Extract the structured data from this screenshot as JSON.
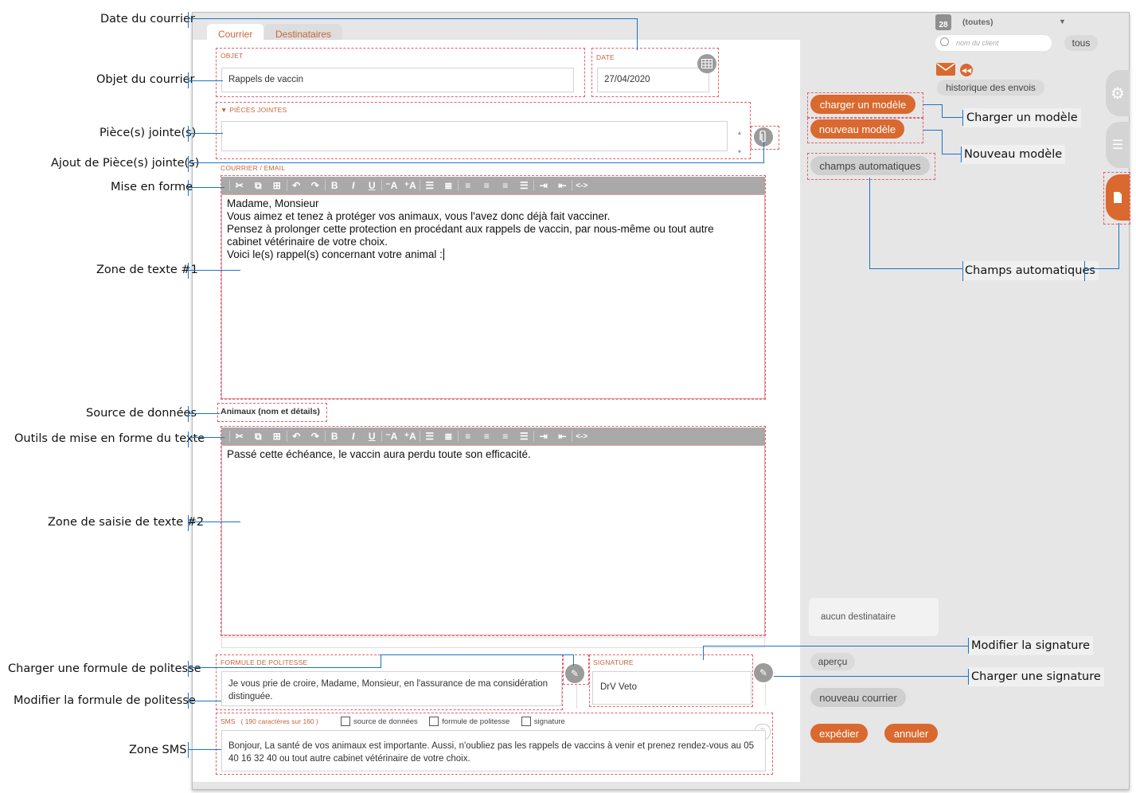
{
  "annotations": {
    "date": "Date du courrier",
    "objet": "Objet du courrier",
    "pieces": "Pièce(s) jointe(s)",
    "ajout_pieces": "Ajout de Pièce(s) jointe(s)",
    "mise_en_forme": "Mise en forme",
    "zone1": "Zone de texte #1",
    "source": "Source de données",
    "outils": "Outils de mise en forme du texte",
    "zone2": "Zone de saisie de texte #2",
    "charger_formule": "Charger une formule de politesse",
    "modifier_formule": "Modifier la formule de politesse",
    "zone_sms": "Zone SMS",
    "charger_modele": "Charger un modèle",
    "nouveau_modele": "Nouveau modèle",
    "champs_auto": "Champs automatiques",
    "modifier_signature": "Modifier la signature",
    "charger_signature": "Charger une signature"
  },
  "tabs": [
    "Courrier",
    "Destinataires"
  ],
  "objet": {
    "label": "OBJET",
    "value": "Rappels de vaccin"
  },
  "date": {
    "label": "DATE",
    "value": "27/04/2020"
  },
  "pieces": {
    "label": "PIÈCES JOINTES"
  },
  "courrier": {
    "label": "COURRIER / EMAIL"
  },
  "editor1_lines": [
    "Madame, Monsieur",
    "Vous aimez et tenez à protéger vos animaux, vous l'avez donc déjà fait vacciner.",
    "Pensez à prolonger cette protection en procédant aux rappels de vaccin, par nous-même ou tout autre",
    "cabinet vétérinaire de votre choix.",
    "Voici le(s) rappel(s) concernant votre animal :"
  ],
  "source_label": "Animaux (nom et détails)",
  "editor2_text": "Passé cette échéance, le vaccin aura perdu toute son efficacité.",
  "politesse": {
    "label": "FORMULE DE POLITESSE",
    "value": "Je vous prie de croire, Madame, Monsieur, en l'assurance de ma considération distinguée."
  },
  "signature": {
    "label": "SIGNATURE",
    "value": "DrV Veto"
  },
  "sms": {
    "label": "SMS",
    "count": "( 190 caractères sur 160 )",
    "checks": [
      "source de données",
      "formule de politesse",
      "signature"
    ],
    "value": "Bonjour, La santé de vos animaux est importante. Aussi, n'oubliez pas les rappels de vaccins à venir et prenez rendez-vous au 05 40 16 32 40 ou tout autre cabinet vétérinaire de votre choix."
  },
  "right": {
    "calendar_day": "28",
    "filter": "(toutes)",
    "search_placeholder": "nom du client",
    "tous": "tous",
    "historique": "historique des envois",
    "charger_modele": "charger un modèle",
    "nouveau_modele": "nouveau modèle",
    "champs_auto": "champs automatiques",
    "aucun_destinataire": "aucun destinataire",
    "apercu": "aperçu",
    "nouveau_courrier": "nouveau courrier",
    "expedier": "expédier",
    "annuler": "annuler"
  },
  "colors": {
    "accent": "#d9692f",
    "annotation_line": "#1a73c8",
    "dashed": "#e06070"
  }
}
